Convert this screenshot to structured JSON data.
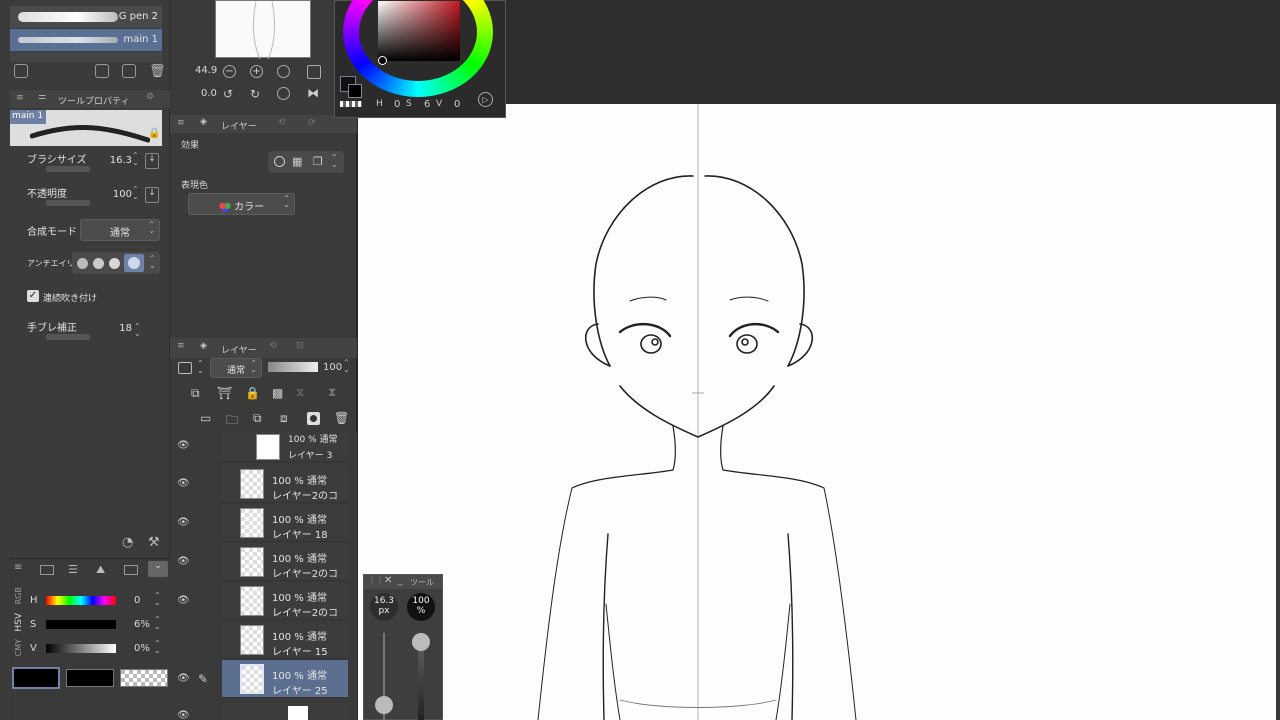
{
  "brushes": {
    "items": [
      {
        "label": "G pen 2",
        "selected": false
      },
      {
        "label": "main 1",
        "selected": true
      }
    ]
  },
  "navigator": {
    "zoom": "44.9",
    "rotation": "0.0"
  },
  "color_wheel": {
    "h": "0",
    "s": "6",
    "v": "0",
    "h_label": "H",
    "s_label": "S",
    "v_label": "V"
  },
  "tool_property": {
    "title": "ツールプロパティ",
    "preset_name": "main 1",
    "brush_size_label": "ブラシサイズ",
    "brush_size_value": "16.3",
    "opacity_label": "不透明度",
    "opacity_value": "100",
    "blend_label": "合成モード",
    "blend_value": "通常",
    "antialias_label": "アンチエイリ",
    "continuous_label": "連続吹き付け",
    "stabilization_label": "手ブレ補正",
    "stabilization_value": "18"
  },
  "layer_property": {
    "tab": "レイヤー",
    "effect_label": "効果",
    "expression_label": "表現色",
    "expression_value": "カラー"
  },
  "layer_panel": {
    "tab": "レイヤー",
    "blend": "通常",
    "opacity": "100",
    "layers": [
      {
        "top": "100 %  通常",
        "name": "レイヤー 3",
        "selected": false
      },
      {
        "top": "100 %  通常",
        "name": "レイヤー2のコ",
        "selected": false
      },
      {
        "top": "100 %  通常",
        "name": "レイヤー 18",
        "selected": false
      },
      {
        "top": "100 %  通常",
        "name": "レイヤー2のコ",
        "selected": false
      },
      {
        "top": "100 %  通常",
        "name": "レイヤー2のコ",
        "selected": false
      },
      {
        "top": "100 %  通常",
        "name": "レイヤー 15",
        "selected": false
      },
      {
        "top": "100 %  通常",
        "name": "レイヤー 25",
        "selected": true
      }
    ]
  },
  "color_slider": {
    "mode_rgb": "RGB",
    "mode_hsv": "HSV",
    "mode_cmy": "CMY",
    "h_label": "H",
    "h_value": "0",
    "s_label": "S",
    "s_value": "6%",
    "v_label": "V",
    "v_value": "0%"
  },
  "float_panel": {
    "title": "ツール",
    "size_value": "16.3",
    "size_unit": "px",
    "opacity_value": "100",
    "opacity_unit": "%",
    "size_level": 0.1,
    "opacity_level": 1.0
  },
  "colors": {
    "accent_selected": "#5d6f90",
    "panel_bg": "#3b3b3b",
    "canvas_bg": "#fdfdfd"
  }
}
